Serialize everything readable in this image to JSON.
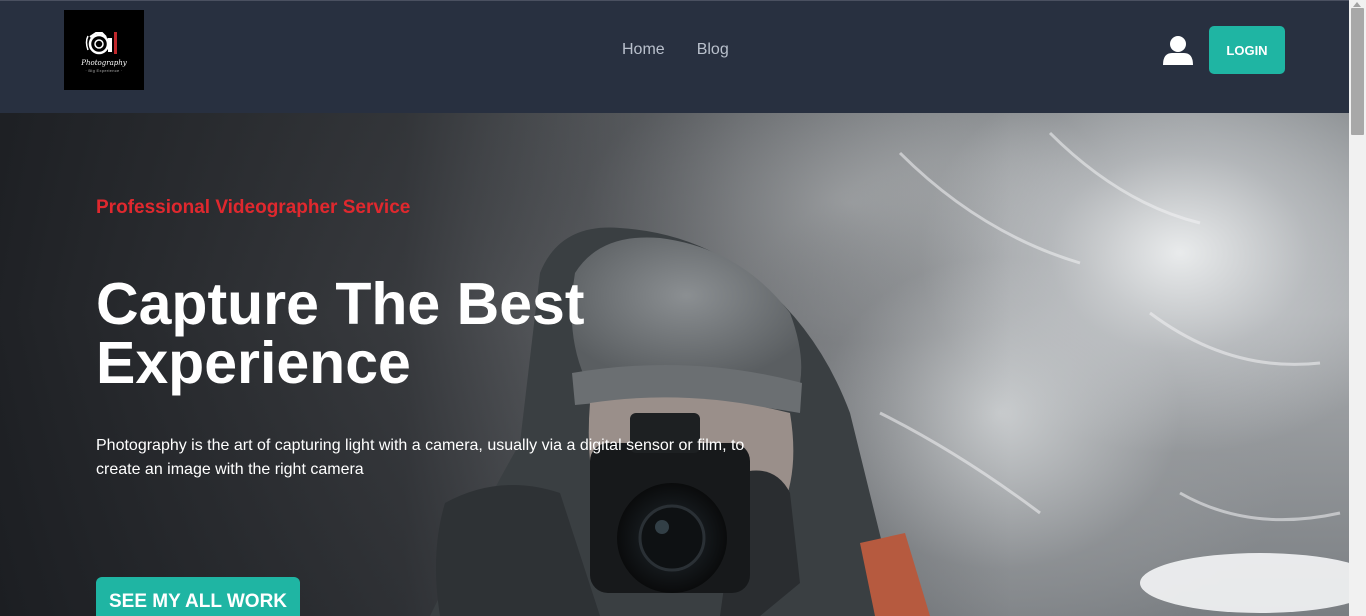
{
  "brand": {
    "logo_icon": "camera-logo-icon",
    "logo_text": "Photography",
    "logo_subtext": "· Big Experience ·"
  },
  "nav": {
    "links": [
      {
        "label": "Home"
      },
      {
        "label": "Blog"
      }
    ],
    "user_icon": "user-icon",
    "login_label": "LOGIN"
  },
  "hero": {
    "kicker": "Professional Videographer Service",
    "headline": "Capture The Best Experience",
    "description": "Photography is the art of capturing light with a camera, usually via a digital sensor or film, to create an image with the right camera",
    "cta_label": "SEE MY ALL WORK"
  },
  "colors": {
    "navbar_bg": "#283040",
    "accent_teal": "#1fb5a3",
    "kicker_red": "#e0282e"
  }
}
